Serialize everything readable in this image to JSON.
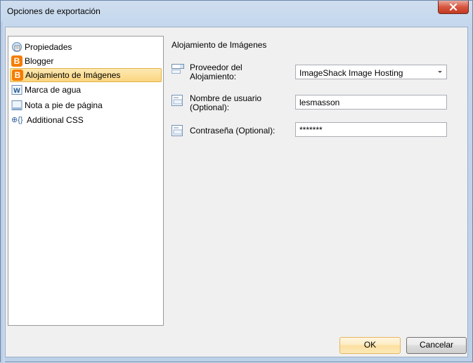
{
  "window": {
    "title": "Opciones de exportación",
    "close_symbol": "✕"
  },
  "sidebar": {
    "items": [
      {
        "label": "Propiedades",
        "icon": "properties-icon"
      },
      {
        "label": "Blogger",
        "icon": "blogger-icon"
      },
      {
        "label": "Alojamiento de Imágenes",
        "icon": "blogger-icon",
        "selected": true
      },
      {
        "label": "Marca de agua",
        "icon": "watermark-icon"
      },
      {
        "label": "Nota a pie de página",
        "icon": "footer-icon"
      },
      {
        "label": "Additional CSS",
        "icon": "css-icon"
      }
    ],
    "blogger_glyph": "B",
    "watermark_glyph": "W",
    "css_glyph": "⊕{}"
  },
  "main": {
    "section_title": "Alojamiento de Imágenes",
    "fields": {
      "provider": {
        "label_line1": "Proveedor del",
        "label_line2": "Alojamiento:",
        "value": "ImageShack Image Hosting"
      },
      "username": {
        "label_line1": "Nombre de usuario",
        "label_line2": "(Optional):",
        "value": "lesmasson"
      },
      "password": {
        "label": "Contraseña (Optional):",
        "value": "*******"
      }
    }
  },
  "buttons": {
    "ok": "OK",
    "cancel": "Cancelar"
  },
  "colors": {
    "selected_bg": "#fbd580",
    "blogger_orange": "#f57d00",
    "close_red": "#d7553f"
  }
}
